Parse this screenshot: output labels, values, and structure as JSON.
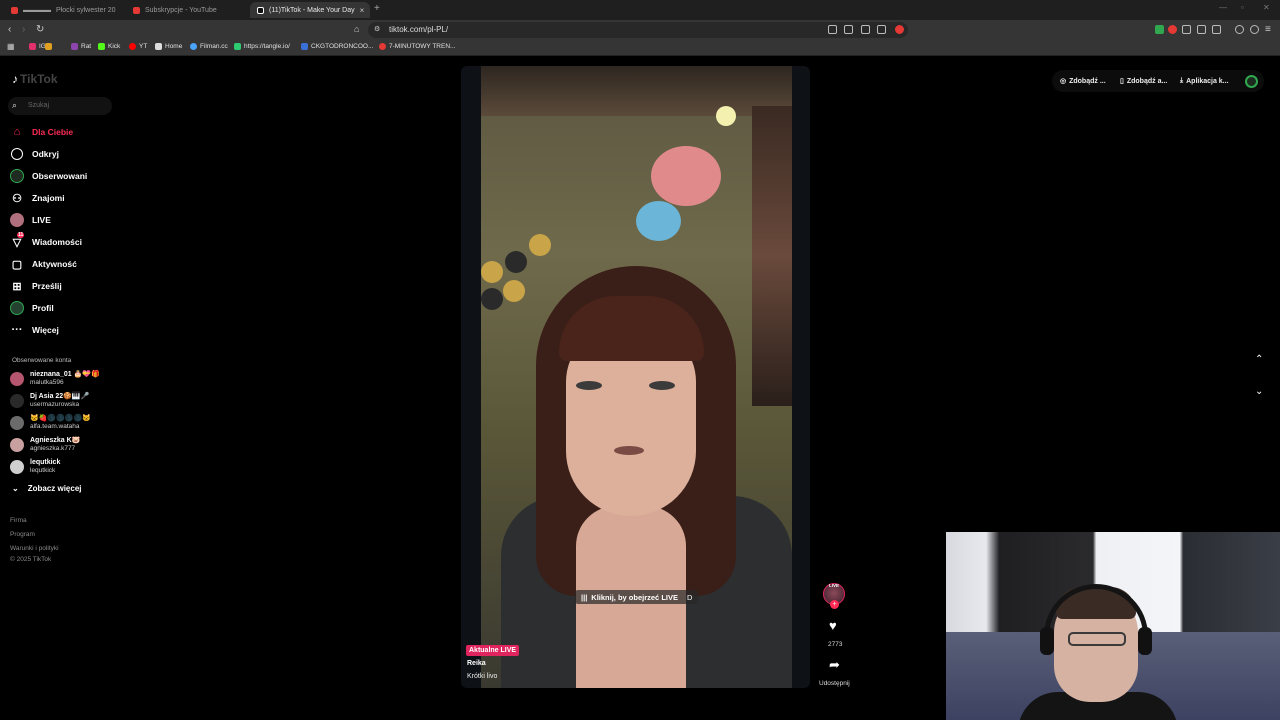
{
  "browser": {
    "tabs": [
      {
        "label": "Płocki sylwester 20",
        "prefix": "▬▬▬▬",
        "color": "#e53935"
      },
      {
        "label": "Subskrypcje - YouTube",
        "color": "#e53935"
      },
      {
        "label": "(11)TikTok - Make Your Day",
        "color": "#ffffff",
        "active": true
      }
    ],
    "url": "tiktok.com/pl-PL/",
    "bookmarks": [
      {
        "label": "IG",
        "color": "#e1306c"
      },
      {
        "label": "Rat",
        "color": "#8e44ad"
      },
      {
        "label": "Kick",
        "color": "#53fc18"
      },
      {
        "label": "YT",
        "color": "#ff0000"
      },
      {
        "label": "Home",
        "color": "#ffffff"
      },
      {
        "label": "Filman.cc",
        "color": "#4aa3ff"
      },
      {
        "label": "https://tangle.io/",
        "color": "#2ecc71"
      },
      {
        "label": "CKGTODRONCOO...",
        "color": "#3a6fd8"
      },
      {
        "label": "7-MINUTOWY TREN...",
        "color": "#e53935"
      }
    ]
  },
  "sidebar": {
    "logo": "TikTok",
    "search_placeholder": "Szukaj",
    "nav": [
      {
        "label": "Dla Ciebie",
        "icon": "home-icon",
        "active": true
      },
      {
        "label": "Odkryj",
        "icon": "compass-icon"
      },
      {
        "label": "Obserwowani",
        "icon": "following-icon"
      },
      {
        "label": "Znajomi",
        "icon": "friends-icon"
      },
      {
        "label": "LIVE",
        "icon": "live-icon"
      },
      {
        "label": "Wiadomości",
        "icon": "messages-icon",
        "badge": "11"
      },
      {
        "label": "Aktywność",
        "icon": "activity-icon"
      },
      {
        "label": "Prześlij",
        "icon": "upload-icon"
      },
      {
        "label": "Profil",
        "icon": "profile-icon"
      },
      {
        "label": "Więcej",
        "icon": "more-icon"
      }
    ],
    "followed_title": "Obserwowane konta",
    "followed": [
      {
        "name": "nieznana_01 🎂💝🎁",
        "handle": "malutka596",
        "color": "#b5566e"
      },
      {
        "name": "Dj Asia 22🍪🎹🎤",
        "handle": "usermazurowska",
        "color": "#2a2a2a"
      },
      {
        "name": "🐱🍓🌑🌑🌑🌑🐱",
        "handle": "alfa.team.wataha",
        "color": "#6b6b6b"
      },
      {
        "name": "Agnieszka K🐷",
        "handle": "agnieszka.k777",
        "color": "#c9a0a0"
      },
      {
        "name": "lequtkick",
        "handle": "lequtkick",
        "color": "#cfcfcf"
      }
    ],
    "see_more": "Zobacz więcej",
    "footer": [
      "Firma",
      "Program",
      "Warunki i polityki",
      "© 2025 TikTok"
    ]
  },
  "video": {
    "cta": "Kliknij, by obejrzeć LIVE",
    "cta_key": "D",
    "badge": "Aktualne LIVE",
    "username": "Reika",
    "description": "Krótki livo"
  },
  "actions": {
    "live_label": "LIVE",
    "likes": "2773",
    "share": "Udostępnij"
  },
  "topbar": {
    "items": [
      "Zdobądź ...",
      "Zdobądź a...",
      "Aplikacja k..."
    ]
  }
}
